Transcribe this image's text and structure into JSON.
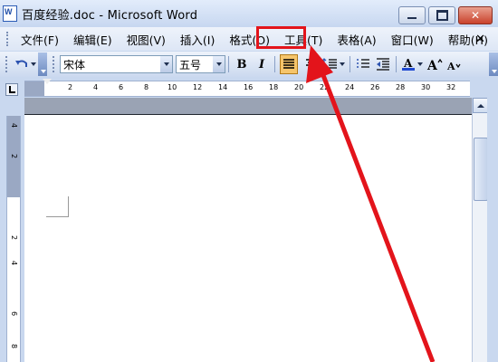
{
  "window": {
    "title": "百度经验.doc - Microsoft Word"
  },
  "menu": {
    "items": [
      {
        "label": "文件(F)"
      },
      {
        "label": "编辑(E)"
      },
      {
        "label": "视图(V)"
      },
      {
        "label": "插入(I)"
      },
      {
        "label": "格式(O)"
      },
      {
        "label": "工具(T)"
      },
      {
        "label": "表格(A)"
      },
      {
        "label": "窗口(W)"
      },
      {
        "label": "帮助(H)"
      }
    ],
    "close_label": "✕"
  },
  "toolbar": {
    "font_name": "宋体",
    "font_size": "五号",
    "bold_label": "B",
    "italic_label": "I"
  },
  "ruler": {
    "ticks": [
      "2",
      "4",
      "6",
      "8",
      "10",
      "12",
      "14",
      "16",
      "18",
      "20",
      "22",
      "24",
      "26",
      "28",
      "30",
      "32"
    ]
  },
  "vruler": {
    "ticks": [
      "4",
      "2",
      "2",
      "4",
      "6",
      "8"
    ]
  },
  "colors": {
    "highlight": "#e3141b",
    "active_button": "#f6c56b",
    "font_color_bar": "#1f49d1"
  }
}
